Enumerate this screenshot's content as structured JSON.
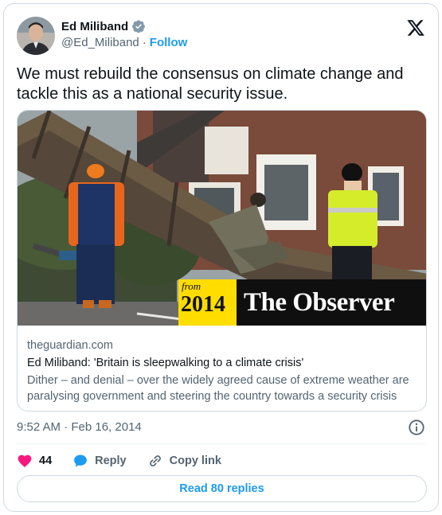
{
  "author": {
    "name": "Ed Miliband",
    "handle": "@Ed_Miliband",
    "separator": "·",
    "follow_label": "Follow"
  },
  "tweet": {
    "text": "We must rebuild the consensus on climate change and tackle this as a national security issue."
  },
  "link_card": {
    "image_badge_year_prefix": "from",
    "image_badge_year": "2014",
    "image_badge_brand": "The Observer",
    "domain": "theguardian.com",
    "title": "Ed Miliband: 'Britain is sleepwalking to a climate crisis'",
    "description": "Dither – and denial – over the widely agreed cause of extreme weather are paralysing government and steering the country towards a security crisis"
  },
  "meta": {
    "timestamp": "9:52 AM · Feb 16, 2014"
  },
  "actions": {
    "like_count": "44",
    "reply_label": "Reply",
    "copy_label": "Copy link"
  },
  "replies_button": "Read 80 replies",
  "colors": {
    "accent": "#1d9bf0",
    "like": "#f91880",
    "badge_yellow": "#ffdd00"
  },
  "icons": [
    "verified-badge-icon",
    "x-logo-icon",
    "info-icon",
    "heart-icon",
    "reply-bubble-icon",
    "link-icon"
  ]
}
